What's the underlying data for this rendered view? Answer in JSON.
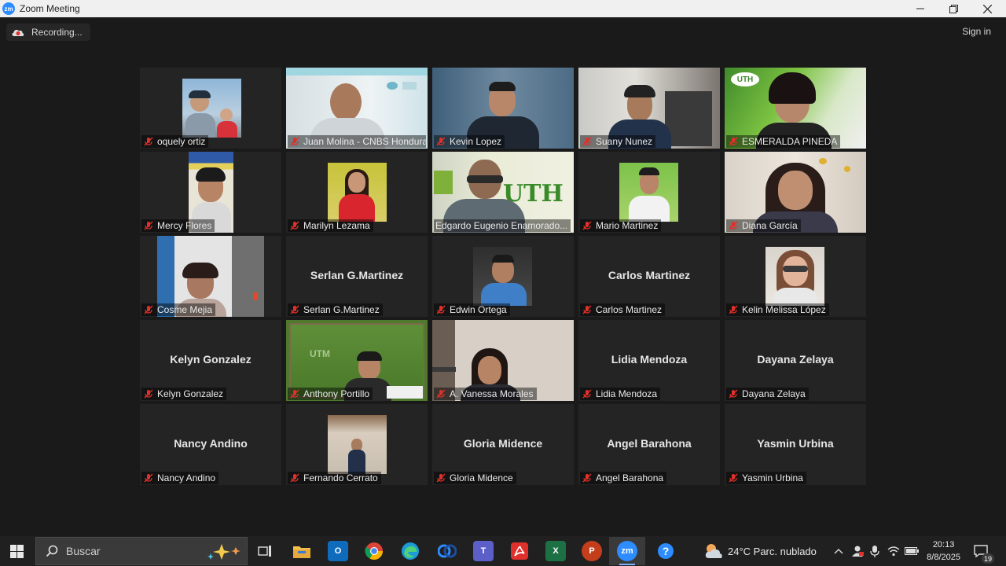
{
  "window": {
    "title": "Zoom Meeting",
    "app_icon_text": "zm"
  },
  "topbar": {
    "recording_label": "Recording...",
    "signin_label": "Sign in"
  },
  "participants": [
    "oquely ortiz",
    "Juan Molina - CNBS Honduras",
    "Kevin Lopez",
    "Suany  Nunez",
    "ESMERALDA PINEDA",
    "Mercy Flores",
    "Marilyn Lezama",
    "Edgardo Eugenio Enamorado...",
    "Mario Martinez",
    "Diana García",
    "Cosme Mejia",
    "Serlan G.Martinez",
    "Edwin Ortega",
    "Carlos Martinez",
    "Kelin Melissa López",
    "Kelyn Gonzalez",
    "Anthony Portillo",
    "A. Vanessa Morales",
    "Lidia Mendoza",
    "Dayana Zelaya",
    "Nancy Andino",
    "Fernando Cerrato",
    "Gloria Midence",
    "Angel Barahona",
    "Yasmin Urbina"
  ],
  "no_video_names": {
    "t11": "Serlan G.Martinez",
    "t13": "Carlos Martinez",
    "t15": "Kelyn Gonzalez",
    "t18": "Lidia Mendoza",
    "t19": "Dayana Zelaya",
    "t20": "Nancy Andino",
    "t22": "Gloria Midence",
    "t23": "Angel Barahona",
    "t24": "Yasmin Urbina"
  },
  "video_text": {
    "utm_logo": "UTH",
    "utm_logo_small": "UTH",
    "utm_logo_board": "UTM"
  },
  "taskbar": {
    "search_placeholder": "Buscar",
    "apps": [
      "task-view",
      "file-explorer",
      "outlook",
      "chrome",
      "edge",
      "webex",
      "teams",
      "acrobat",
      "excel",
      "powerpoint",
      "zoom",
      "help"
    ],
    "app_labels": {
      "zoom": "zm",
      "outlook": "O",
      "excel": "X",
      "powerpoint": "P",
      "teams": "T"
    },
    "weather": "24°C  Parc. nublado",
    "time": "20:13",
    "date": "8/8/2025",
    "notifications": "19"
  },
  "colors": {
    "accent": "#2d8cff",
    "speaking": "#9acd32",
    "muted_mic": "#e0302b"
  }
}
